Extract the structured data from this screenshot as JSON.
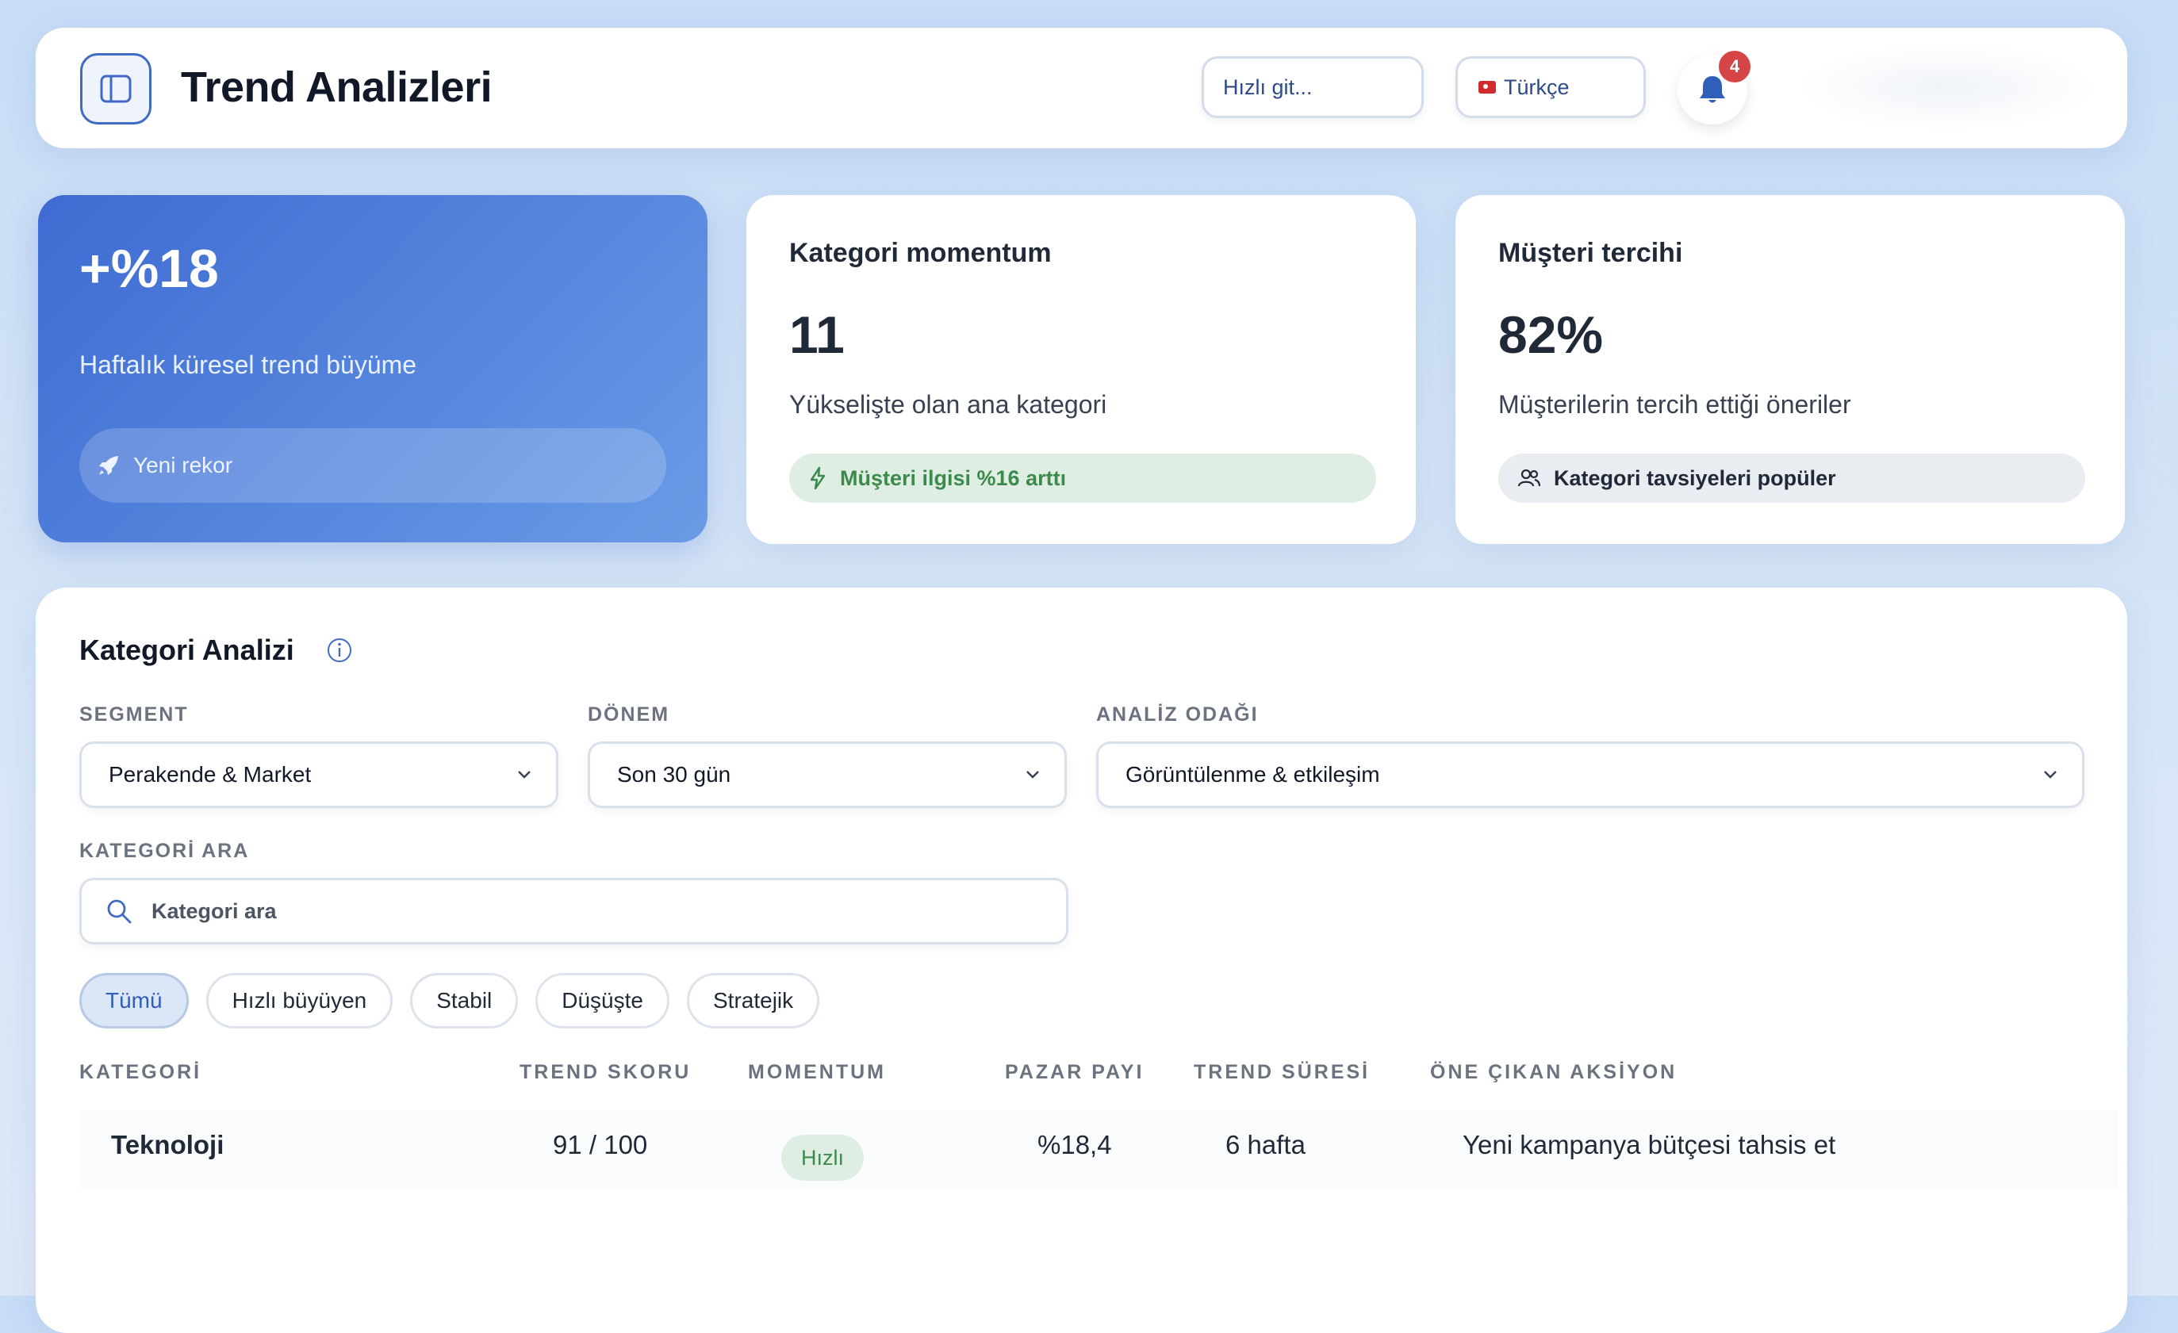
{
  "header": {
    "title": "Trend Analizleri",
    "quick_go_placeholder": "Hızlı git...",
    "language": "Türkçe",
    "notification_count": "4"
  },
  "stats": {
    "growth": {
      "value": "+%18",
      "description": "Haftalık küresel trend büyüme",
      "pill": "Yeni rekor"
    },
    "momentum": {
      "title": "Kategori momentum",
      "value": "11",
      "description": "Yükselişte olan ana kategori",
      "pill": "Müşteri ilgisi %16 arttı"
    },
    "preference": {
      "title": "Müşteri tercihi",
      "value": "82%",
      "description": "Müşterilerin tercih ettiği öneriler",
      "pill": "Kategori tavsiyeleri popüler"
    }
  },
  "analysis": {
    "title": "Kategori Analizi",
    "filters": {
      "segment": {
        "label": "SEGMENT",
        "value": "Perakende & Market"
      },
      "period": {
        "label": "DÖNEM",
        "value": "Son 30 gün"
      },
      "focus": {
        "label": "ANALİZ ODAĞI",
        "value": "Görüntülenme & etkileşim"
      }
    },
    "search": {
      "label": "KATEGORİ ARA",
      "placeholder": "Kategori ara"
    },
    "chips": [
      "Tümü",
      "Hızlı büyüyen",
      "Stabil",
      "Düşüşte",
      "Stratejik"
    ],
    "columns": [
      "KATEGORİ",
      "TREND SKORU",
      "MOMENTUM",
      "PAZAR PAYI",
      "TREND SÜRESİ",
      "ÖNE ÇIKAN AKSİYON"
    ],
    "rows": [
      {
        "category": "Teknoloji",
        "score": "91 / 100",
        "momentum": "Hızlı",
        "share": "%18,4",
        "duration": "6 hafta",
        "action": "Yeni kampanya bütçesi tahsis et"
      }
    ]
  },
  "colors": {
    "accent": "#3f6bc4",
    "success": "#3d8a4e",
    "danger": "#d64545"
  },
  "icons": {
    "sidebar_toggle": "sidebar-panel-icon",
    "bell": "bell-icon",
    "rocket": "rocket-icon",
    "bolt": "bolt-icon",
    "users": "users-icon",
    "info": "info-icon",
    "search": "search-icon",
    "chevron": "chevron-down-icon"
  }
}
